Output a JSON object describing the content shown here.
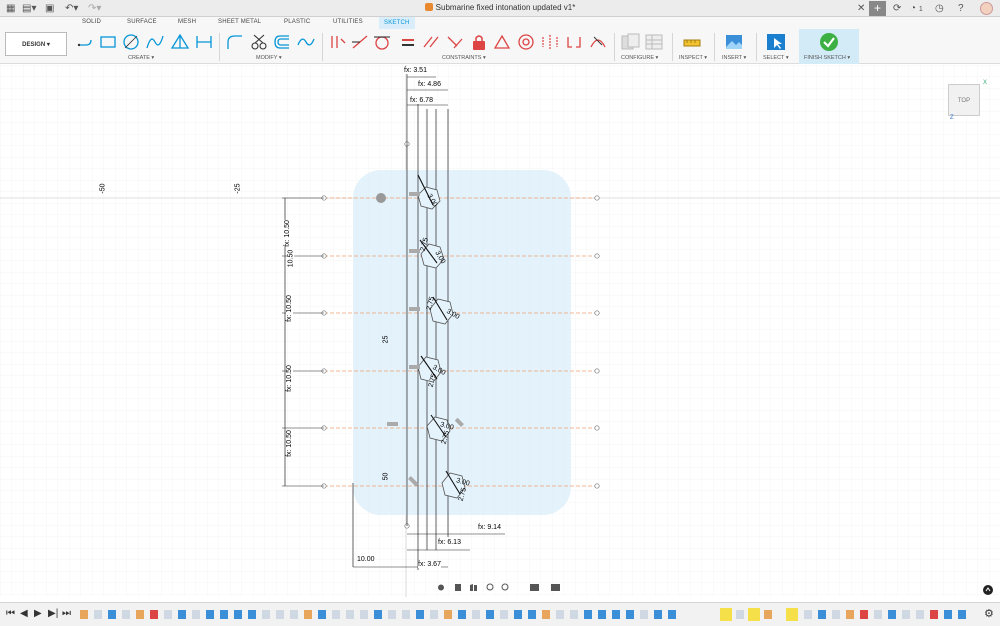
{
  "titlebar": {
    "document_title": "Submarine fixed intonation updated v1*",
    "notification_count": "1"
  },
  "tabs": [
    "SOLID",
    "SURFACE",
    "MESH",
    "SHEET METAL",
    "PLASTIC",
    "UTILITIES",
    "SKETCH"
  ],
  "active_tab": "SKETCH",
  "ribbon": {
    "design_button": "DESIGN ▾",
    "groups": {
      "create": "CREATE ▾",
      "modify": "MODIFY ▾",
      "constraints": "CONSTRAINTS ▾",
      "configure": "CONFIGURE ▾",
      "inspect": "INSPECT ▾",
      "insert": "INSERT ▾",
      "select": "SELECT ▾",
      "finish_sketch": "FINISH SKETCH ▾"
    }
  },
  "viewcube": {
    "face": "TOP",
    "axis_x": "X",
    "axis_z": "Z"
  },
  "sketch": {
    "grid_labels": {
      "neg50": "-50",
      "neg25": "-25",
      "v25": "25",
      "v50": "50"
    },
    "top_dims": [
      "fx: 3.51",
      "fx: 4.86",
      "fx: 6.78"
    ],
    "left_dims": [
      "fx: 10.50",
      "10.50",
      "fx: 10.50",
      "fx: 10.50",
      "fx: 10.50"
    ],
    "bottom_dims": [
      "fx: 9.14",
      "fx: 6.13",
      "10.00",
      "fx: 3.67"
    ],
    "hex_dims": [
      "3.00",
      "3.00",
      "3.00",
      "3.00",
      "3.00",
      "3.00"
    ],
    "small_dims": [
      "2.75",
      "2.75",
      "2.75",
      "2.75",
      "2.75"
    ],
    "accent_color": "#0696d7",
    "dashed_line_color": "#f0a070",
    "profile_fill": "#dbeefb"
  }
}
